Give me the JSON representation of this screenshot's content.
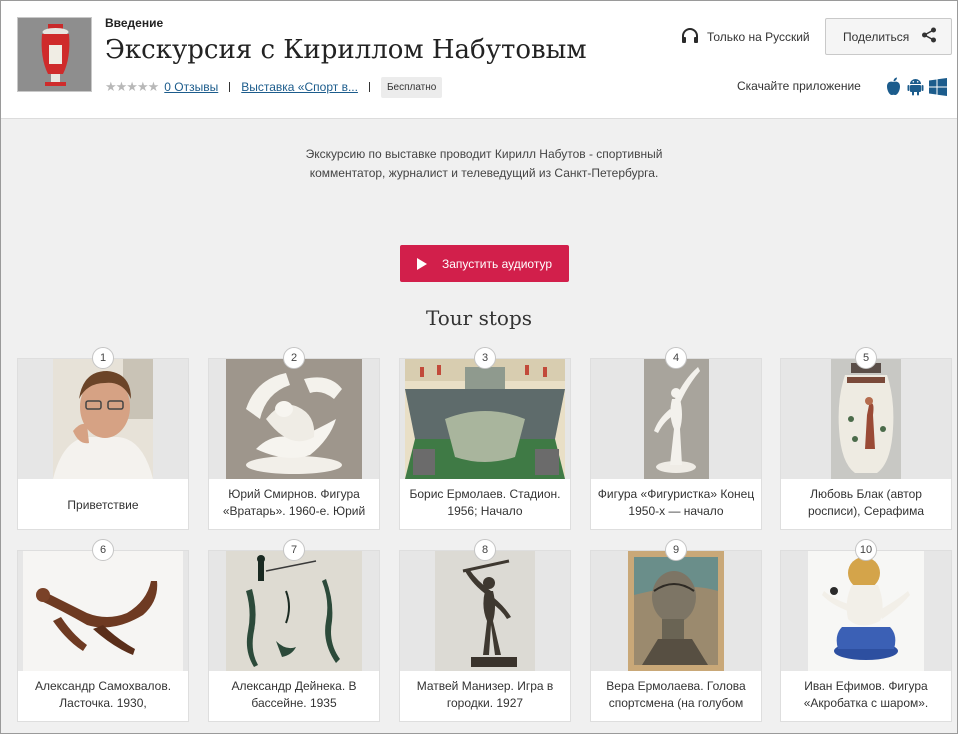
{
  "header": {
    "section_label": "Введение",
    "title": "Экскурсия с Кириллом Набутовым",
    "stars": "★★★★★",
    "reviews": "0 Отзывы",
    "exhibition": "Выставка «Спорт в...",
    "price": "Бесплатно",
    "language": "Только на Русский",
    "share": "Поделиться",
    "app_label": "Скачайте приложение"
  },
  "intro": {
    "description": "Экскурсию по выставке проводит Кирилл Набутов - спортивный комментатор, журналист и телеведущий из Санкт-Петербурга.",
    "play_button": "Запустить аудиотур",
    "stops_title": "Tour stops"
  },
  "stops": [
    {
      "num": "1",
      "caption": "Приветствие"
    },
    {
      "num": "2",
      "caption": "Юрий Смирнов. Фигура «Вратарь». 1960-е. Юрий"
    },
    {
      "num": "3",
      "caption": "Борис Ермолаев. Стадион. 1956; Начало"
    },
    {
      "num": "4",
      "caption": "Фигура «Фигуристка» Конец 1950-х — начало"
    },
    {
      "num": "5",
      "caption": "Любовь Блак (автор росписи), Серафима"
    },
    {
      "num": "6",
      "caption": "Александр Самохвалов. Ласточка. 1930,"
    },
    {
      "num": "7",
      "caption": "Александр Дейнека. В бассейне. 1935"
    },
    {
      "num": "8",
      "caption": "Матвей Манизер. Игра в городки. 1927"
    },
    {
      "num": "9",
      "caption": "Вера Ермолаева. Голова спортсмена (на голубом"
    },
    {
      "num": "10",
      "caption": "Иван Ефимов. Фигура «Акробатка с шаром»."
    }
  ],
  "icons": {
    "headphones": "headphones-icon",
    "share": "share-icon",
    "apple": "apple-icon",
    "android": "android-icon",
    "windows": "windows-icon"
  },
  "colors": {
    "accent": "#d21f4b",
    "link": "#1c5c8c",
    "background": "#f0f0f0"
  }
}
